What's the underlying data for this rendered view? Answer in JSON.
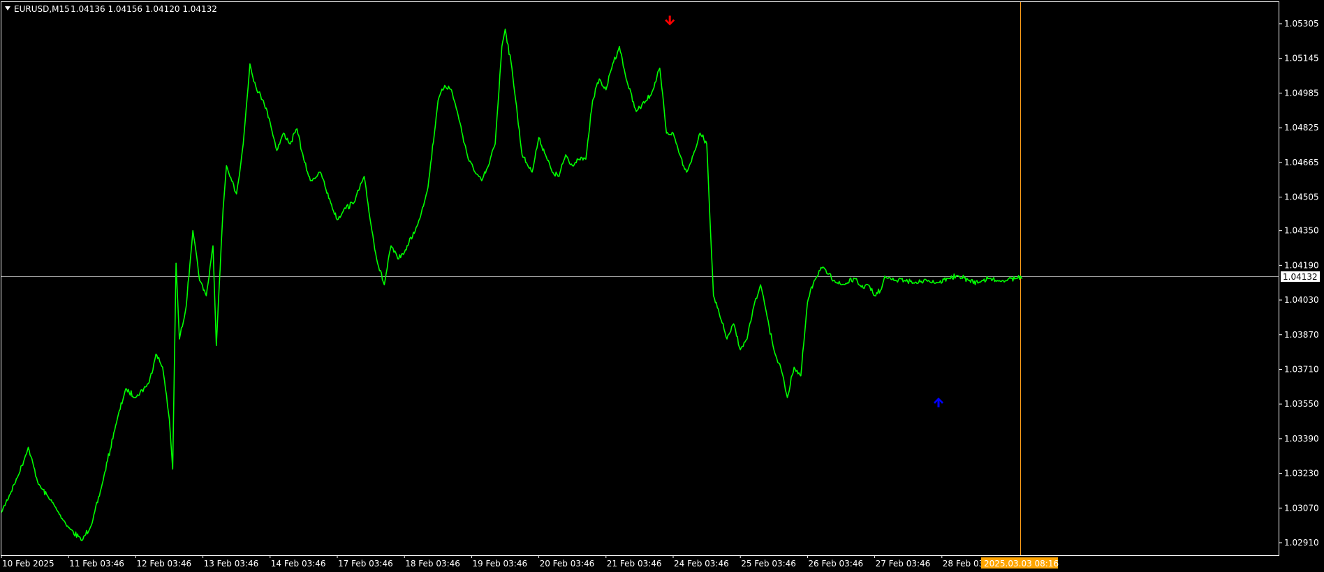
{
  "header": {
    "symbol": "EURUSD,M15",
    "ohlc": "1.04136 1.04156 1.04120 1.04132",
    "menu_icon": "triangle-down-icon"
  },
  "colors": {
    "background": "#000000",
    "series": "#00ff00",
    "axis": "#ffffff",
    "bid_line": "#a0a0a0",
    "cursor_line": "#ff9f1a",
    "time_tag": "#ffa500",
    "down_arrow": "#ff0000",
    "up_arrow": "#0000ff"
  },
  "price_tag": "1.04132",
  "time_tag": "2025.03.03 08:16",
  "chart_data": {
    "type": "line",
    "title": "",
    "xlabel": "",
    "ylabel": "",
    "ylim": [
      1.0285,
      1.0535
    ],
    "grid": false,
    "y_ticks": [
      "1.05305",
      "1.05145",
      "1.04985",
      "1.04825",
      "1.04665",
      "1.04505",
      "1.04350",
      "1.04190",
      "1.04030",
      "1.03870",
      "1.03710",
      "1.03550",
      "1.03390",
      "1.03230",
      "1.03070",
      "1.02910"
    ],
    "x_ticks": [
      "10 Feb 2025",
      "11 Feb 03:46",
      "12 Feb 03:46",
      "13 Feb 03:46",
      "14 Feb 03:46",
      "17 Feb 03:46",
      "18 Feb 03:46",
      "19 Feb 03:46",
      "20 Feb 03:46",
      "21 Feb 03:46",
      "24 Feb 03:46",
      "25 Feb 03:46",
      "26 Feb 03:46",
      "27 Feb 03:46",
      "28 Feb 03:46"
    ],
    "current_price": 1.04132,
    "series": [
      {
        "x": [
          0,
          0.25,
          0.4,
          0.55,
          0.7,
          0.85,
          1.0,
          1.2,
          1.35,
          1.5,
          1.7,
          1.85,
          2.0,
          2.2,
          2.3,
          2.4,
          2.5,
          2.55,
          2.6,
          2.65,
          2.75,
          2.85,
          2.95,
          3.05,
          3.15,
          3.2,
          3.3,
          3.35,
          3.4,
          3.5,
          3.6,
          3.7,
          3.8,
          3.9,
          4.0,
          4.1,
          4.2,
          4.3,
          4.4,
          4.5,
          4.6,
          4.75,
          4.9,
          5.0,
          5.1,
          5.25,
          5.4,
          5.5,
          5.6,
          5.7,
          5.8,
          5.9,
          6.0,
          6.2,
          6.35,
          6.5,
          6.6,
          6.7,
          6.8,
          6.95,
          7.05,
          7.15,
          7.25,
          7.35,
          7.45,
          7.5,
          7.6,
          7.75,
          7.9,
          8.0,
          8.1,
          8.2,
          8.3,
          8.4,
          8.5,
          8.6,
          8.7,
          8.8,
          8.9,
          9.0,
          9.1,
          9.2,
          9.3,
          9.45,
          9.6,
          9.7,
          9.8,
          9.9,
          10.0,
          10.1,
          10.2,
          10.3,
          10.4,
          10.5,
          10.6,
          10.7,
          10.8,
          10.9,
          11.0,
          11.1,
          11.2,
          11.3,
          11.4,
          11.5,
          11.6,
          11.7,
          11.8,
          11.9,
          12.0,
          12.1,
          12.2,
          12.3,
          12.4,
          12.5,
          12.6,
          12.7,
          12.8,
          12.9,
          13.0,
          13.1,
          13.15,
          13.2,
          13.3,
          13.45,
          13.6,
          13.8,
          13.95,
          14.1,
          14.25,
          14.4,
          14.55,
          14.6,
          14.7,
          14.8,
          14.9,
          15.0,
          15.1,
          15.2
        ],
        "y": [
          1.0305,
          1.0322,
          1.0335,
          1.0318,
          1.0312,
          1.0305,
          1.0298,
          1.0292,
          1.03,
          1.0318,
          1.0345,
          1.0362,
          1.0358,
          1.0365,
          1.0378,
          1.0372,
          1.0348,
          1.0325,
          1.042,
          1.0385,
          1.04,
          1.0435,
          1.0412,
          1.0405,
          1.0428,
          1.0382,
          1.0445,
          1.0465,
          1.046,
          1.0452,
          1.0475,
          1.0512,
          1.05,
          1.0495,
          1.0485,
          1.0472,
          1.048,
          1.0475,
          1.0482,
          1.0468,
          1.0458,
          1.0462,
          1.0448,
          1.044,
          1.0445,
          1.0448,
          1.046,
          1.0438,
          1.042,
          1.041,
          1.0428,
          1.0422,
          1.0425,
          1.0438,
          1.0455,
          1.0495,
          1.0502,
          1.05,
          1.0488,
          1.0468,
          1.0462,
          1.0458,
          1.0465,
          1.0475,
          1.052,
          1.0528,
          1.051,
          1.047,
          1.0462,
          1.0478,
          1.047,
          1.0462,
          1.046,
          1.047,
          1.0465,
          1.0468,
          1.0468,
          1.0495,
          1.0505,
          1.05,
          1.0512,
          1.052,
          1.0505,
          1.049,
          1.0495,
          1.05,
          1.051,
          1.048,
          1.048,
          1.047,
          1.0462,
          1.047,
          1.048,
          1.0475,
          1.0405,
          1.0395,
          1.0385,
          1.0392,
          1.038,
          1.0385,
          1.04,
          1.041,
          1.0395,
          1.038,
          1.0372,
          1.0358,
          1.0372,
          1.0368,
          1.0402,
          1.0412,
          1.0418,
          1.0415,
          1.0412,
          1.041,
          1.0411,
          1.0413,
          1.0409,
          1.041,
          1.0405,
          1.0408,
          1.0414,
          1.0413,
          1.0412,
          1.0412,
          1.0411,
          1.0412,
          1.0411,
          1.0413,
          1.0414,
          1.0412,
          1.0411,
          1.0412,
          1.0413,
          1.0412,
          1.0412,
          1.0413,
          1.0413,
          1.0413
        ]
      }
    ],
    "arrows": [
      {
        "type": "down",
        "x": 9.95,
        "y": 1.0531
      },
      {
        "type": "up",
        "x": 13.95,
        "y": 1.0358
      }
    ]
  }
}
